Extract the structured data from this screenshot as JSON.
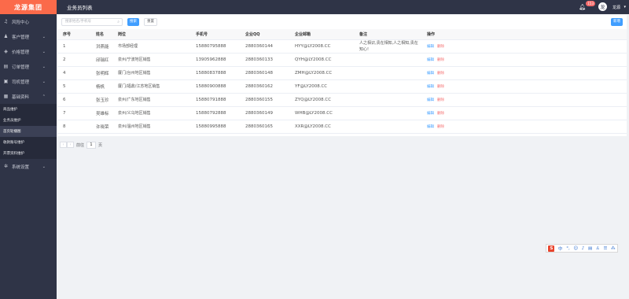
{
  "brand": "龙源集团",
  "page_title": "业务员列表",
  "notification_count": "153",
  "username": "龙源",
  "avatar_letter": "龙",
  "menu": [
    {
      "label": "风险中心",
      "icon": "bell-icon",
      "glyph": "♫"
    },
    {
      "label": "客户管理",
      "icon": "user-icon",
      "glyph": "♟"
    },
    {
      "label": "价格管理",
      "icon": "price-icon",
      "glyph": "◈"
    },
    {
      "label": "订单管理",
      "icon": "order-icon",
      "glyph": "▤"
    },
    {
      "label": "司机管理",
      "icon": "driver-icon",
      "glyph": "▣"
    },
    {
      "label": "基础资料",
      "icon": "data-icon",
      "glyph": "▦"
    }
  ],
  "submenu": [
    {
      "label": "商品维护"
    },
    {
      "label": "业务员维护"
    },
    {
      "label": "首页轮播图"
    },
    {
      "label": "收款账号维护"
    },
    {
      "label": "开票资料维护"
    }
  ],
  "menu_settings": {
    "label": "系统设置",
    "icon": "gear-icon",
    "glyph": "✲"
  },
  "toolbar": {
    "search_placeholder": "搜索姓名/手机号",
    "search_label": "搜索",
    "reset_label": "重置",
    "add_label": "新增"
  },
  "table": {
    "headers": [
      "序号",
      "姓名",
      "岗位",
      "手机号",
      "企业QQ",
      "企业邮箱",
      "备注",
      "操作"
    ],
    "rows": [
      {
        "no": "1",
        "name": "洪燕能",
        "position": "市场部经理",
        "phone": "15880795888",
        "qq": "2880360144",
        "email": "HYY@LY2008.CC",
        "remark": "人之相识,贵在相知,人之相知,贵在知心!"
      },
      {
        "no": "2",
        "name": "邱瑞红",
        "position": "泉州/宁波地区销售",
        "phone": "13905962888",
        "qq": "2880360133",
        "email": "QYH@LY2008.CC",
        "remark": ""
      },
      {
        "no": "4",
        "name": "张明辉",
        "position": "厦门/台州地区销售",
        "phone": "15880837888",
        "qq": "2880360148",
        "email": "ZMH@LY2008.CC",
        "remark": ""
      },
      {
        "no": "5",
        "name": "杨帆",
        "position": "厦门/福鼎/江苏地区销售",
        "phone": "15880900888",
        "qq": "2880360162",
        "email": "YF@LY2008.CC",
        "remark": ""
      },
      {
        "no": "6",
        "name": "张玉珍",
        "position": "泉州/广东地区销售",
        "phone": "15880791888",
        "qq": "2880360155",
        "email": "ZYQ@LY2008.CC",
        "remark": ""
      },
      {
        "no": "7",
        "name": "吴雄标",
        "position": "泉州/义乌地区销售",
        "phone": "15880792888",
        "qq": "2880360149",
        "email": "WHB@LY2008.CC",
        "remark": ""
      },
      {
        "no": "8",
        "name": "许晓荣",
        "position": "泉州/温州地区销售",
        "phone": "15880995888",
        "qq": "2880360165",
        "email": "XXR@LY2008.CC",
        "remark": ""
      }
    ],
    "edit_label": "编辑",
    "delete_label": "删除"
  },
  "pagination": {
    "goto_label": "前往",
    "page_value": "1",
    "page_suffix": "页"
  },
  "ime": {
    "logo": "S",
    "items": [
      "中",
      "°,",
      "☺",
      "♪",
      "▤",
      "♙",
      "☰",
      "⁂"
    ]
  },
  "colors": {
    "sidebar_bg": "#2f3447",
    "brand_bg": "#fb6a4a",
    "primary": "#409eff",
    "danger": "#f56c6c"
  }
}
